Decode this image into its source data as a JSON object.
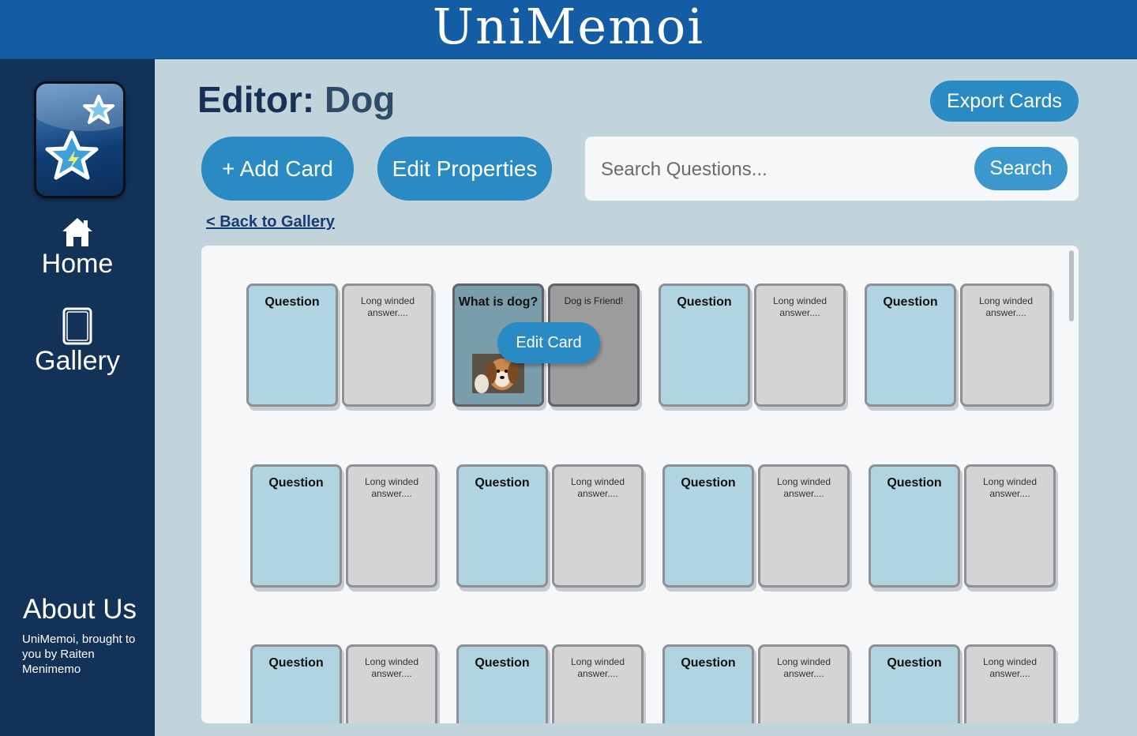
{
  "header": {
    "app_title": "UniMemoi"
  },
  "sidebar": {
    "nav": [
      {
        "label": "Home",
        "icon": "home-icon"
      },
      {
        "label": "Gallery",
        "icon": "card-icon"
      }
    ],
    "about": {
      "heading": "About Us",
      "text": "UniMemoi, brought to you by Raiten Menimemo"
    }
  },
  "editor": {
    "title_prefix": "Editor:",
    "deck_name": "Dog",
    "export_label": "Export Cards",
    "add_card_label": "+ Add Card",
    "edit_properties_label": "Edit Properties",
    "search": {
      "placeholder": "Search Questions...",
      "button_label": "Search"
    },
    "back_link": "< Back to Gallery"
  },
  "cards": [
    {
      "question": "Question",
      "answer": "Long winded answer...."
    },
    {
      "question": "What is dog?",
      "answer": "Dog is Friend!",
      "active": true,
      "has_image": true,
      "edit_label": "Edit Card"
    },
    {
      "question": "Question",
      "answer": "Long winded answer...."
    },
    {
      "question": "Question",
      "answer": "Long winded answer...."
    },
    {
      "question": "Question",
      "answer": "Long winded answer...."
    },
    {
      "question": "Question",
      "answer": "Long winded answer...."
    },
    {
      "question": "Question",
      "answer": "Long winded answer...."
    },
    {
      "question": "Question",
      "answer": "Long winded answer...."
    },
    {
      "question": "Question",
      "answer": "Long winded answer...."
    },
    {
      "question": "Question",
      "answer": "Long winded answer...."
    },
    {
      "question": "Question",
      "answer": "Long winded answer...."
    },
    {
      "question": "Question",
      "answer": "Long winded answer...."
    }
  ],
  "colors": {
    "header_bg": "#145da4",
    "sidebar_bg": "#133257",
    "accent_button": "#2a8ac4",
    "card_front": "#b1d4e1",
    "card_back": "#d4d4d4"
  }
}
